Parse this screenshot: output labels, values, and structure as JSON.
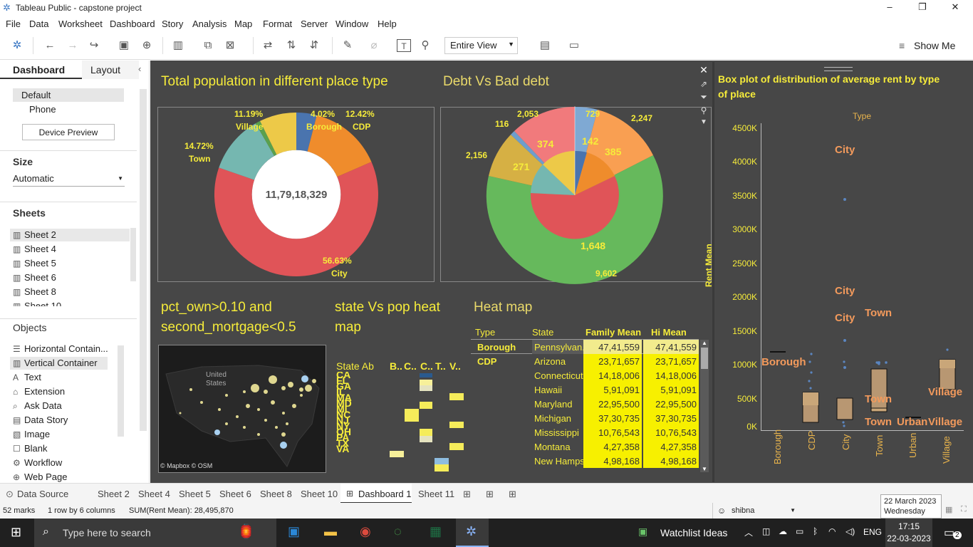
{
  "window": {
    "title": "Tableau Public - capstone project",
    "minimize": "–",
    "restore": "❐",
    "close": "✕"
  },
  "menu": [
    "File",
    "Data",
    "Worksheet",
    "Dashboard",
    "Story",
    "Analysis",
    "Map",
    "Format",
    "Server",
    "Window",
    "Help"
  ],
  "toolbar": {
    "view_select": "Entire View",
    "show_me": "Show Me"
  },
  "left_panel": {
    "tab_dashboard": "Dashboard",
    "tab_layout": "Layout",
    "devices": [
      "Default",
      "Phone"
    ],
    "device_preview_button": "Device Preview",
    "size_header": "Size",
    "size_value": "Automatic",
    "sheets_header": "Sheets",
    "sheets": [
      "Sheet 2",
      "Sheet 4",
      "Sheet 5",
      "Sheet 6",
      "Sheet 8",
      "Sheet 10"
    ],
    "objects_header": "Objects",
    "objects": [
      "Horizontal Contain...",
      "Vertical Container",
      "Text",
      "Extension",
      "Ask Data",
      "Data Story",
      "Image",
      "Blank",
      "Workflow",
      "Web Page"
    ]
  },
  "dashboard": {
    "donut": {
      "title": "Total population in different place type",
      "center_value": "11,79,18,329",
      "labels": [
        {
          "pct": "4.02%",
          "name": "Borough"
        },
        {
          "pct": "12.42%",
          "name": "CDP"
        },
        {
          "pct": "56.63%",
          "name": "City"
        },
        {
          "pct": "14.72%",
          "name": "Town"
        },
        {
          "pct": "11.19%",
          "name": "Village"
        }
      ]
    },
    "pie": {
      "title": "Debt Vs Bad debt",
      "outer_labels": [
        "2,053",
        "729",
        "2,247",
        "116",
        "2,156",
        "9,602"
      ],
      "inner_labels": [
        "374",
        "142",
        "385",
        "271",
        "1,648"
      ]
    },
    "map": {
      "title_line1": "pct_own>0.10 and",
      "title_line2": "second_mortgage<0.5",
      "country_label": "United States",
      "attribution": "© Mapbox © OSM"
    },
    "state_heat": {
      "title_line1": "state Vs pop heat",
      "title_line2": "map",
      "row_header": "State Ab",
      "col_headers": [
        "B..",
        "C..",
        "C..",
        "T..",
        "V.."
      ],
      "states": [
        "CA",
        "FL",
        "GA",
        "IL",
        "MA",
        "MD",
        "MI",
        "NC",
        "NJ",
        "NY",
        "OH",
        "PA",
        "TX",
        "VA"
      ]
    },
    "heatmap_table": {
      "title": "Heat map",
      "headers": [
        "Type",
        "State",
        "Family Mean",
        "Hi Mean"
      ],
      "rows": [
        [
          "Borough",
          "Pennsylvan..",
          "47,41,559",
          "47,41,559"
        ],
        [
          "CDP",
          "Arizona",
          "23,71,657",
          "23,71,657"
        ],
        [
          "",
          "Connecticut",
          "14,18,006",
          "14,18,006"
        ],
        [
          "",
          "Hawaii",
          "5,91,091",
          "5,91,091"
        ],
        [
          "",
          "Maryland",
          "22,95,500",
          "22,95,500"
        ],
        [
          "",
          "Michigan",
          "37,30,735",
          "37,30,735"
        ],
        [
          "",
          "Mississippi",
          "10,76,543",
          "10,76,543"
        ],
        [
          "",
          "Montana",
          "4,27,358",
          "4,27,358"
        ],
        [
          "",
          "New Hamps..",
          "4,98,168",
          "4,98,168"
        ]
      ]
    },
    "boxplot": {
      "title_line1": "Box plot of distribution of average rent by type",
      "title_line2": "of place",
      "header": "Type",
      "y_title": "Rent Mean",
      "y_ticks": [
        "4500K",
        "4000K",
        "3500K",
        "3000K",
        "2500K",
        "2000K",
        "1500K",
        "1000K",
        "500K",
        "0K"
      ],
      "categories": [
        "Borough",
        "CDP",
        "City",
        "Town",
        "Urban",
        "Village"
      ],
      "annotations": [
        "City",
        "City",
        "City",
        "Town",
        "Borough",
        "Town",
        "Town",
        "Urban",
        "Village",
        "Village"
      ]
    }
  },
  "bottom_tabs": [
    "Data Source",
    "Sheet 2",
    "Sheet 4",
    "Sheet 5",
    "Sheet 6",
    "Sheet 8",
    "Sheet 10",
    "Dashboard 1",
    "Sheet 11"
  ],
  "status": {
    "marks": "52 marks",
    "rows": "1 row by 6 columns",
    "sum": "SUM(Rent Mean): 28,495,870",
    "user": "shibna"
  },
  "tooltip_date": {
    "line1": "22 March 2023",
    "line2": "Wednesday"
  },
  "taskbar": {
    "search": "Type here to search",
    "widget": "Watchlist Ideas",
    "lang": "ENG",
    "time": "17:15",
    "date": "22-03-2023",
    "notif": "2"
  }
}
